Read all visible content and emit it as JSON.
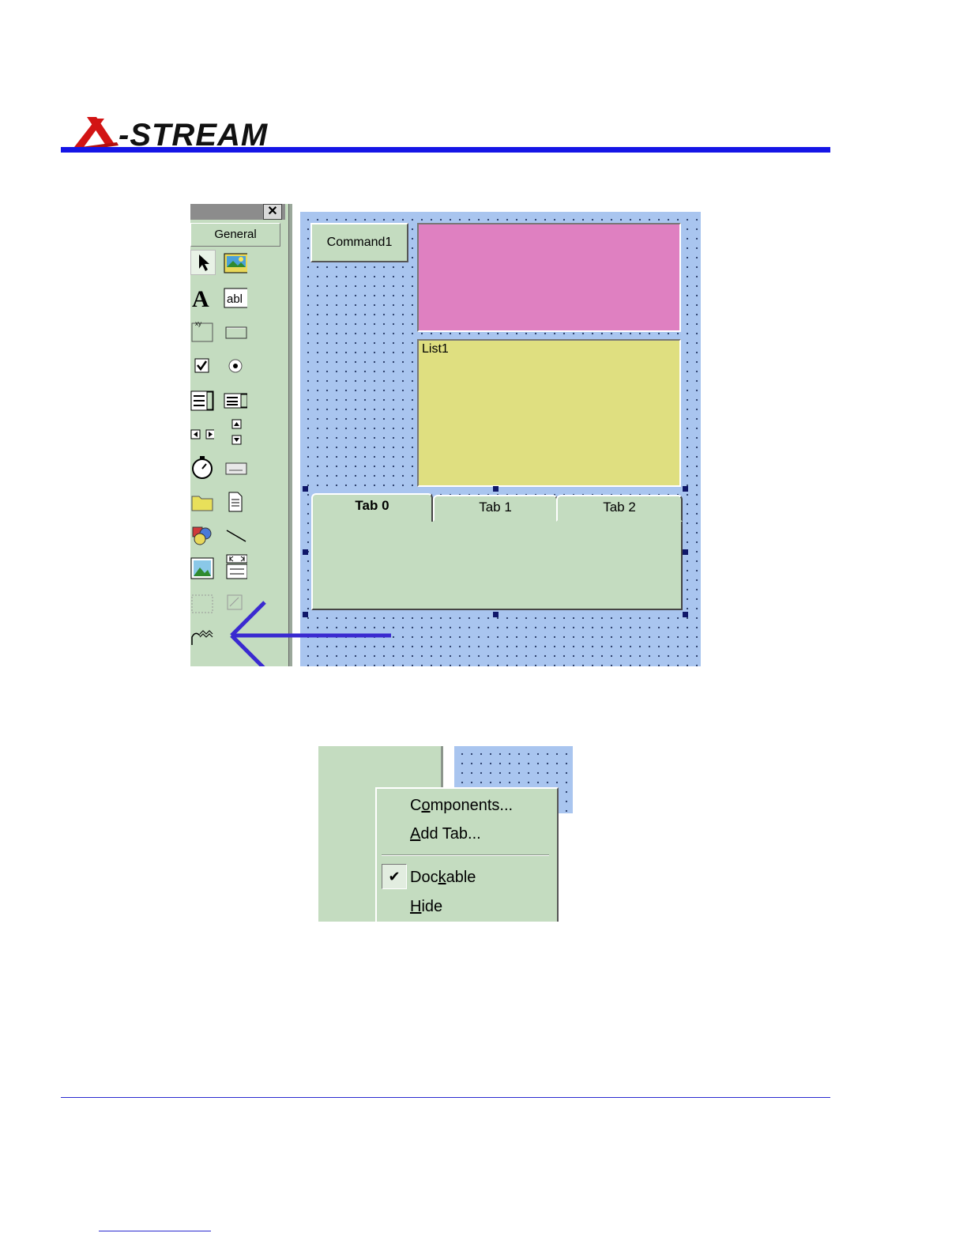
{
  "header": {
    "logo_text": "X-STREAM",
    "logo_x": "X",
    "logo_rest": "-STREAM",
    "rule_color": "#1515e6"
  },
  "screenshot1": {
    "toolbox": {
      "close_label": "✕",
      "tab_label": "General",
      "tools": [
        {
          "name": "pointer-icon"
        },
        {
          "name": "picture-box-icon"
        },
        {
          "name": "label-icon"
        },
        {
          "name": "textbox-icon"
        },
        {
          "name": "frame-icon"
        },
        {
          "name": "command-button-icon"
        },
        {
          "name": "checkbox-icon"
        },
        {
          "name": "option-button-icon"
        },
        {
          "name": "combobox-icon"
        },
        {
          "name": "listbox-icon"
        },
        {
          "name": "hscrollbar-icon"
        },
        {
          "name": "vscrollbar-icon"
        },
        {
          "name": "timer-icon"
        },
        {
          "name": "drive-list-icon"
        },
        {
          "name": "dir-list-icon"
        },
        {
          "name": "file-list-icon"
        },
        {
          "name": "shape-icon"
        },
        {
          "name": "line-icon"
        },
        {
          "name": "image-icon"
        },
        {
          "name": "data-icon"
        },
        {
          "name": "ole-icon"
        },
        {
          "name": "ole2-icon"
        },
        {
          "name": "custom-control-icon"
        }
      ]
    },
    "form": {
      "command_button_label": "Command1",
      "list_label": "List1",
      "tabs": [
        "Tab 0",
        "Tab 1",
        "Tab 2"
      ],
      "colors": {
        "form": "#a9c5ef",
        "pink": "#df80c1",
        "yellow": "#dfdf80",
        "panel": "#c4dcc0",
        "arrow": "#3a2ad0"
      }
    }
  },
  "screenshot2": {
    "context_menu": {
      "items": [
        {
          "label": "Components...",
          "pre": "C",
          "ul": "o",
          "post": "mponents..."
        },
        {
          "label": "Add Tab...",
          "pre": "",
          "ul": "A",
          "post": "dd Tab..."
        },
        {
          "label": "Dockable",
          "pre": "Doc",
          "ul": "k",
          "post": "able",
          "checked": true
        },
        {
          "label": "Hide",
          "pre": "",
          "ul": "H",
          "post": "ide"
        }
      ],
      "check_mark": "✔"
    }
  }
}
